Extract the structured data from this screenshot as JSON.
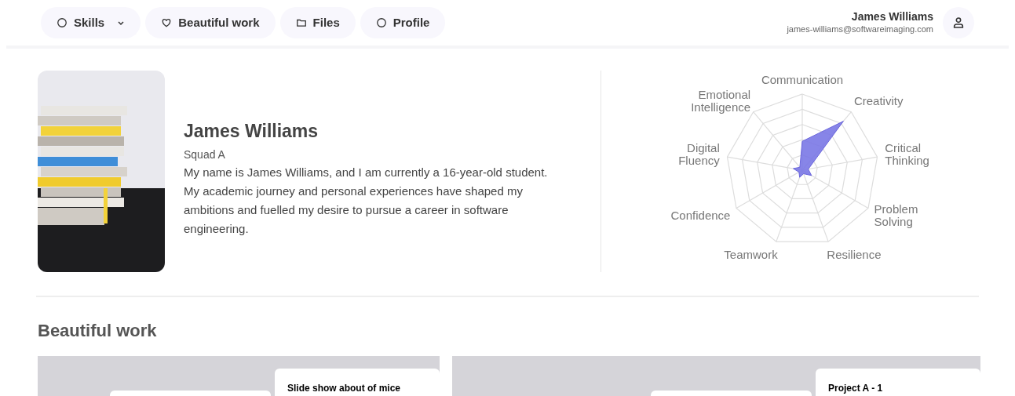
{
  "nav": {
    "items": [
      {
        "label": "Skills",
        "dropdown": true
      },
      {
        "label": "Beautiful work",
        "dropdown": false
      },
      {
        "label": "Files",
        "dropdown": false
      },
      {
        "label": "Profile",
        "dropdown": false
      }
    ]
  },
  "user": {
    "name": "James Williams",
    "email": "james-williams@softwareimaging.com"
  },
  "profile": {
    "name": "James Williams",
    "group": "Squad A",
    "bio": "My name is James Williams, and I am currently a 16-year-old student. My academic journey and personal experiences have shaped my ambitions and fuelled my desire to pursue a career in software engineering."
  },
  "skills_chart": {
    "axes": [
      [
        "Communication"
      ],
      [
        "Emotional",
        "Intelligence"
      ],
      [
        "Creativity"
      ],
      [
        "Digital",
        "Fluency"
      ],
      [
        "Critical",
        "Thinking"
      ],
      [
        "Confidence"
      ],
      [
        "Problem",
        "Solving"
      ],
      [
        "Teamwork"
      ],
      [
        "Resilience"
      ]
    ]
  },
  "section": {
    "title": "Beautiful work"
  },
  "works": [
    {
      "title": "Slide show about of mice"
    },
    {
      "title": "Project A - 1"
    }
  ]
}
